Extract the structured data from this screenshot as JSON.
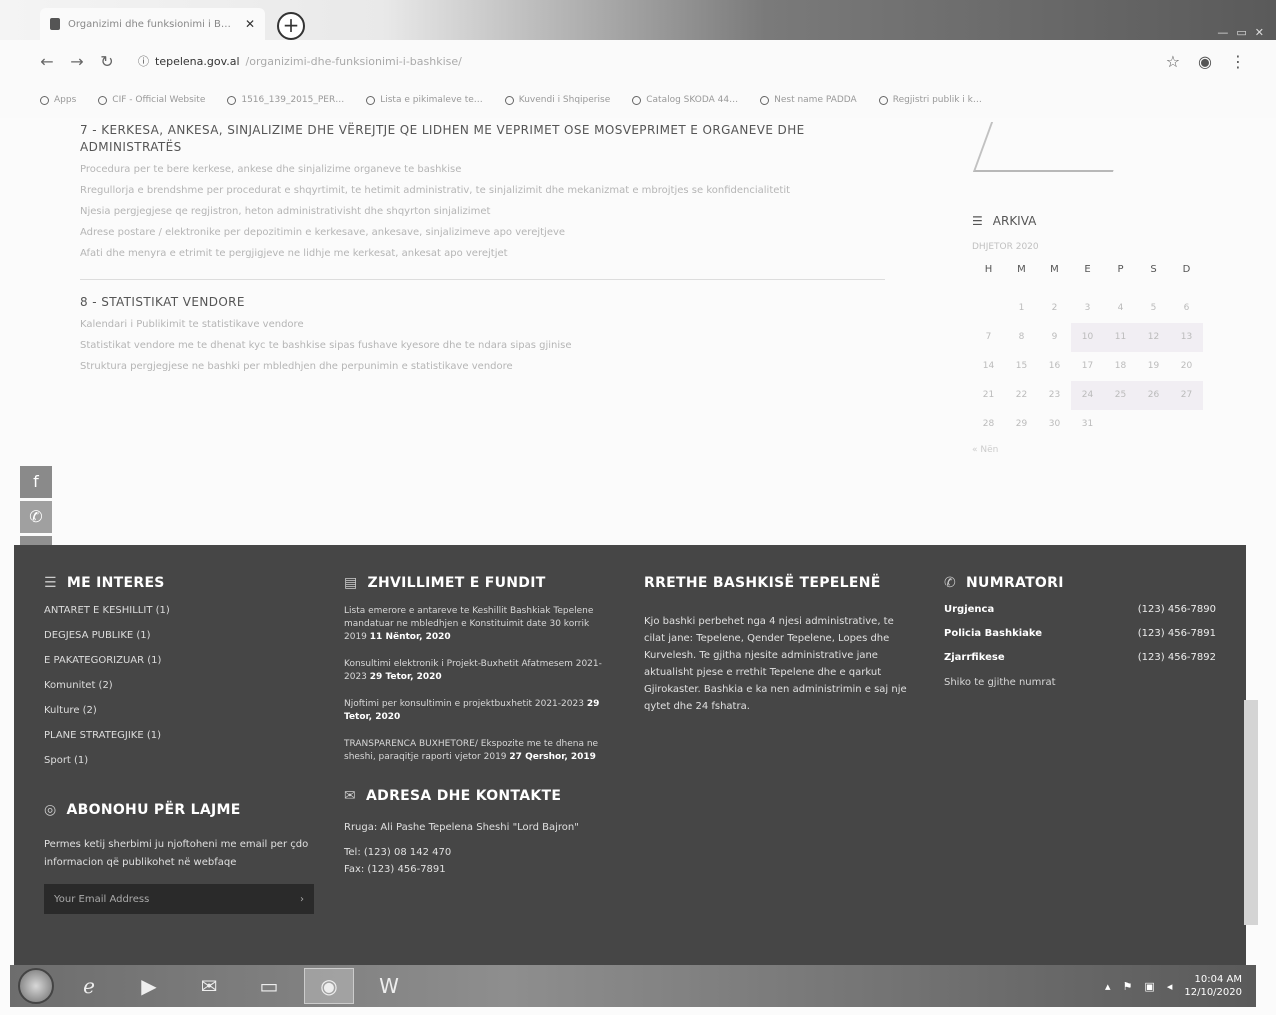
{
  "browser": {
    "tab_title": "Organizimi dhe funksionimi i B…",
    "url_domain": "tepelena.gov.al",
    "url_path": "/organizimi-dhe-funksionimi-i-bashkise/",
    "bookmarks": [
      "Apps",
      "CIF - Official Website",
      "1516_139_2015_PER…",
      "Lista e pikimaleve te…",
      "Kuvendi i Shqiperise",
      "Catalog SKODA 44…",
      "Nest name PADDA",
      "Regjistri publik i k…"
    ]
  },
  "content": {
    "section7_title": "7 - KERKESA, ANKESA, SINJALIZIME DHE VËREJTJE QE LIDHEN ME VEPRIMET OSE MOSVEPRIMET E ORGANEVE DHE ADMINISTRATËS",
    "section7_links": [
      "Procedura per te bere kerkese, ankese dhe sinjalizime organeve te bashkise",
      "Rregullorja e brendshme per procedurat e shqyrtimit, te hetimit administrativ, te sinjalizimit dhe mekanizmat e mbrojtjes se konfidencialitetit",
      "Njesia pergjegjese qe regjistron, heton administrativisht dhe shqyrton sinjalizimet",
      "Adrese postare / elektronike per depozitimin e kerkesave, ankesave, sinjalizimeve apo verejtjeve",
      "Afati dhe menyra e etrimit te pergjigjeve ne lidhje me kerkesat, ankesat apo verejtjet"
    ],
    "section8_title": "8 - STATISTIKAT VENDORE",
    "section8_links": [
      "Kalendari i Publikimit te statistikave vendore",
      "Statistikat vendore me te dhenat kyc te bashkise sipas fushave kyesore dhe te ndara sipas gjinise",
      "Struktura pergjegjese ne bashki per mbledhjen dhe perpunimin e statistikave vendore"
    ]
  },
  "sidebar": {
    "arkiva_label": "ARKIVA",
    "month": "DHJETOR 2020",
    "weekdays": [
      "H",
      "M",
      "M",
      "E",
      "P",
      "S",
      "D"
    ],
    "days": [
      "",
      "1",
      "2",
      "3",
      "4",
      "5",
      "6",
      "7",
      "8",
      "9",
      "10",
      "11",
      "12",
      "13",
      "14",
      "15",
      "16",
      "17",
      "18",
      "19",
      "20",
      "21",
      "22",
      "23",
      "24",
      "25",
      "26",
      "27",
      "28",
      "29",
      "30",
      "31",
      "",
      "",
      ""
    ],
    "prev_link": "« Nën"
  },
  "footer": {
    "interes_title": "ME INTERES",
    "interes_items": [
      "ANTARET E KESHILLIT (1)",
      "DEGJESA PUBLIKE (1)",
      "E PAKATEGORIZUAR (1)",
      "Komunitet (2)",
      "Kulture (2)",
      "PLANE STRATEGJIKE (1)",
      "Sport (1)"
    ],
    "news_title": "ZHVILLIMET E FUNDIT",
    "news": [
      {
        "text": "Lista emerore e antareve te Keshillit Bashkiak Tepelene mandatuar ne mbledhjen e Konstituimit date 30 korrik 2019",
        "date": "11 Nëntor, 2020"
      },
      {
        "text": "Konsultimi elektronik i Projekt-Buxhetit Afatmesem 2021-2023",
        "date": "29 Tetor, 2020"
      },
      {
        "text": "Njoftimi per konsultimin e projektbuxhetit 2021-2023",
        "date": "29 Tetor, 2020"
      },
      {
        "text": "TRANSPARENCA BUXHETORE/ Ekspozite me te dhena ne sheshi, paraqitje raporti vjetor 2019",
        "date": "27 Qershor, 2019"
      }
    ],
    "about_title": "RRETHE BASHKISË TEPELENË",
    "about_text": "Kjo bashki perbehet nga 4 njesi administrative, te cilat jane: Tepelene, Qender Tepelene, Lopes dhe Kurvelesh. Te gjitha njesite administrative jane aktualisht pjese e rrethit Tepelene dhe e qarkut Gjirokaster. Bashkia e ka nen administrimin e saj nje qytet dhe 24 fshatra.",
    "num_title": "NUMRATORI",
    "numbers": [
      {
        "label": "Urgjenca",
        "value": "(123) 456-7890"
      },
      {
        "label": "Policia Bashkiake",
        "value": "(123) 456-7891"
      },
      {
        "label": "Zjarrfikese",
        "value": "(123) 456-7892"
      }
    ],
    "num_more": "Shiko te gjithe numrat",
    "subscribe_title": "ABONOHU PËR LAJME",
    "subscribe_text": "Permes ketij sherbimi ju njoftoheni me email per çdo informacion që publikohet në webfaqe",
    "email_placeholder": "Your Email Address",
    "contact_title": "ADRESA DHE KONTAKTE",
    "address": "Rruga: Ali Pashe Tepelena Sheshi \"Lord Bajron\"",
    "tel": "Tel: (123) 08 142 470",
    "fax": "Fax: (123) 456-7891"
  },
  "taskbar": {
    "time": "10:04 AM",
    "date": "12/10/2020"
  }
}
